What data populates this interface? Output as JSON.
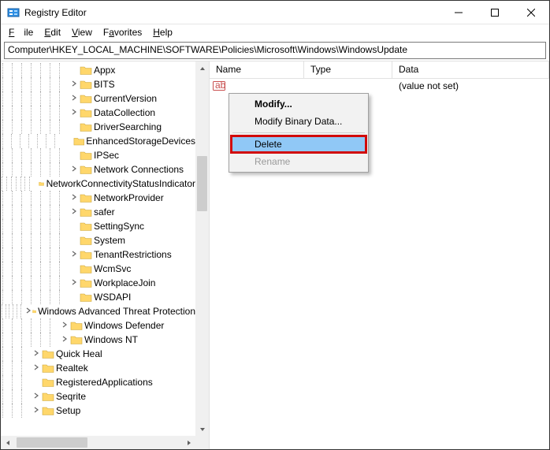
{
  "title": "Registry Editor",
  "menubar": {
    "file": "File",
    "edit": "Edit",
    "view": "View",
    "favorites": "Favorites",
    "help": "Help"
  },
  "address": "Computer\\HKEY_LOCAL_MACHINE\\SOFTWARE\\Policies\\Microsoft\\Windows\\WindowsUpdate",
  "columns": {
    "name": "Name",
    "type": "Type",
    "data": "Data"
  },
  "valueRow": {
    "name": "",
    "type": "",
    "data": "(value not set)"
  },
  "context": {
    "modify": "Modify...",
    "modifyBinary": "Modify Binary Data...",
    "delete": "Delete",
    "rename": "Rename"
  },
  "tree": [
    {
      "depth": 11,
      "chev": "none",
      "label": "Appx"
    },
    {
      "depth": 11,
      "chev": "right",
      "label": "BITS"
    },
    {
      "depth": 11,
      "chev": "right",
      "label": "CurrentVersion"
    },
    {
      "depth": 11,
      "chev": "right",
      "label": "DataCollection"
    },
    {
      "depth": 11,
      "chev": "none",
      "label": "DriverSearching"
    },
    {
      "depth": 11,
      "chev": "none",
      "label": "EnhancedStorageDevices"
    },
    {
      "depth": 11,
      "chev": "none",
      "label": "IPSec"
    },
    {
      "depth": 11,
      "chev": "right",
      "label": "Network Connections"
    },
    {
      "depth": 11,
      "chev": "none",
      "label": "NetworkConnectivityStatusIndicator"
    },
    {
      "depth": 11,
      "chev": "right",
      "label": "NetworkProvider"
    },
    {
      "depth": 11,
      "chev": "right",
      "label": "safer"
    },
    {
      "depth": 11,
      "chev": "none",
      "label": "SettingSync"
    },
    {
      "depth": 11,
      "chev": "none",
      "label": "System"
    },
    {
      "depth": 11,
      "chev": "right",
      "label": "TenantRestrictions"
    },
    {
      "depth": 11,
      "chev": "none",
      "label": "WcmSvc"
    },
    {
      "depth": 11,
      "chev": "right",
      "label": "WorkplaceJoin"
    },
    {
      "depth": 11,
      "chev": "none",
      "label": "WSDAPI"
    },
    {
      "depth": 10,
      "chev": "right",
      "label": "Windows Advanced Threat Protection"
    },
    {
      "depth": 10,
      "chev": "right",
      "label": "Windows Defender"
    },
    {
      "depth": 10,
      "chev": "right",
      "label": "Windows NT"
    },
    {
      "depth": 7,
      "chev": "right",
      "label": "Quick Heal"
    },
    {
      "depth": 7,
      "chev": "right",
      "label": "Realtek"
    },
    {
      "depth": 7,
      "chev": "none",
      "label": "RegisteredApplications"
    },
    {
      "depth": 7,
      "chev": "right",
      "label": "Seqrite"
    },
    {
      "depth": 7,
      "chev": "right",
      "label": "Setup"
    }
  ]
}
